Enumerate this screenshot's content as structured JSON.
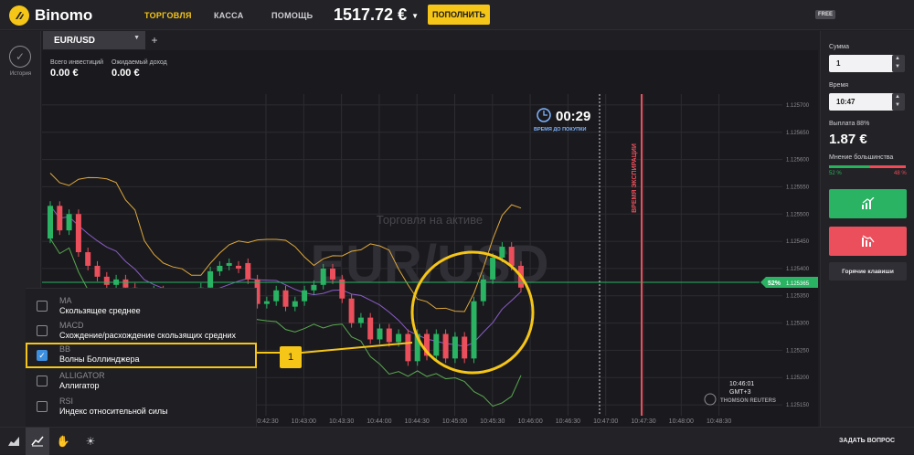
{
  "header": {
    "brand": "Binomo",
    "nav": [
      "ТОРГОВЛЯ",
      "КАССА",
      "ПОМОЩЬ"
    ],
    "balance": "1517.72 €",
    "deposit_label": "ПОПОЛНИТЬ",
    "free_badge": "FREE"
  },
  "left_rail": {
    "history_label": "История"
  },
  "asset_tab": {
    "label": "EUR/USD",
    "add_label": "+"
  },
  "investment": {
    "total_label": "Всего инвестиций",
    "total_value": "0.00 €",
    "expected_label": "Ожидаемый доход",
    "expected_value": "0.00 €"
  },
  "chart": {
    "timer": "00:29",
    "timer_caption": "ВРЕМЯ ДО ПОКУПКИ",
    "expiry_label": "ВРЕМЯ ЭКСПИРАЦИИ",
    "watermark_caption": "Торговля на активе",
    "watermark_asset": "EUR/USD",
    "clock": "10:46:01",
    "timezone": "GMT+3",
    "provider": "THOMSON REUTERS",
    "current_pct": "52%",
    "current_price": "1.125365",
    "price_ticks": [
      "1.125700",
      "1.125650",
      "1.125600",
      "1.125550",
      "1.125500",
      "1.125450",
      "1.125400",
      "1.125350",
      "1.125300",
      "1.125250",
      "1.125200",
      "1.125150"
    ],
    "time_ticks": [
      "10:42:30",
      "10:43:00",
      "10:43:30",
      "10:44:00",
      "10:44:30",
      "10:45:00",
      "10:45:30",
      "10:46:00",
      "10:46:30",
      "10:47:00",
      "10:47:30",
      "10:48:00",
      "10:48:30"
    ],
    "colors": {
      "up": "#29b362",
      "down": "#ea4f5b",
      "bb_upper": "#e0a83a",
      "bb_mid": "#8a5cc7",
      "bb_lower": "#5aa84f",
      "expiry": "#ea4f5b",
      "highlight": "#f5c518"
    }
  },
  "chart_data": {
    "type": "candlestick",
    "title": "",
    "candles": [
      {
        "o": 1.125455,
        "c": 1.125515
      },
      {
        "o": 1.125515,
        "c": 1.12547
      },
      {
        "o": 1.12547,
        "c": 1.1255
      },
      {
        "o": 1.1255,
        "c": 1.12543
      },
      {
        "o": 1.12543,
        "c": 1.125405
      },
      {
        "o": 1.125405,
        "c": 1.125385
      },
      {
        "o": 1.125385,
        "c": 1.12537
      },
      {
        "o": 1.12537,
        "c": 1.12538
      },
      {
        "o": 1.12538,
        "c": 1.125365
      },
      {
        "o": 1.125365,
        "c": 1.125355
      },
      {
        "o": 1.125355,
        "c": 1.125345
      },
      {
        "o": 1.125345,
        "c": 1.12536
      },
      {
        "o": 1.12536,
        "c": 1.12535
      },
      {
        "o": 1.12535,
        "c": 1.12534
      },
      {
        "o": 1.12534,
        "c": 1.125355
      },
      {
        "o": 1.125355,
        "c": 1.125345
      },
      {
        "o": 1.125345,
        "c": 1.125365
      },
      {
        "o": 1.125365,
        "c": 1.125395
      },
      {
        "o": 1.125395,
        "c": 1.125405
      },
      {
        "o": 1.125405,
        "c": 1.12541
      },
      {
        "o": 1.125405,
        "c": 1.1254
      },
      {
        "o": 1.12541,
        "c": 1.12538
      },
      {
        "o": 1.12538,
        "c": 1.125335
      },
      {
        "o": 1.125335,
        "c": 1.12534
      },
      {
        "o": 1.12534,
        "c": 1.12536
      },
      {
        "o": 1.12536,
        "c": 1.12533
      },
      {
        "o": 1.12533,
        "c": 1.12534
      },
      {
        "o": 1.12534,
        "c": 1.12536
      },
      {
        "o": 1.12536,
        "c": 1.12537
      },
      {
        "o": 1.12537,
        "c": 1.1254
      },
      {
        "o": 1.1254,
        "c": 1.12538
      },
      {
        "o": 1.12538,
        "c": 1.125345
      },
      {
        "o": 1.125345,
        "c": 1.1253
      },
      {
        "o": 1.1253,
        "c": 1.12531
      },
      {
        "o": 1.12531,
        "c": 1.12527
      },
      {
        "o": 1.12527,
        "c": 1.12529
      },
      {
        "o": 1.12529,
        "c": 1.125265
      },
      {
        "o": 1.125265,
        "c": 1.12528
      },
      {
        "o": 1.12528,
        "c": 1.12523
      },
      {
        "o": 1.12523,
        "c": 1.12528
      },
      {
        "o": 1.12528,
        "c": 1.12524
      },
      {
        "o": 1.12524,
        "c": 1.12528
      },
      {
        "o": 1.12528,
        "c": 1.125235
      },
      {
        "o": 1.125235,
        "c": 1.125275
      },
      {
        "o": 1.125275,
        "c": 1.125235
      },
      {
        "o": 1.125235,
        "c": 1.12534
      },
      {
        "o": 1.12534,
        "c": 1.12538
      },
      {
        "o": 1.12538,
        "c": 1.12542
      },
      {
        "o": 1.12542,
        "c": 1.12544
      },
      {
        "o": 1.12544,
        "c": 1.125405
      },
      {
        "o": 1.125405,
        "c": 1.125365
      }
    ],
    "ylim": [
      1.12513,
      1.12572
    ]
  },
  "right_panel": {
    "amount_label": "Сумма",
    "amount_value": "1",
    "time_label": "Время",
    "time_value": "10:47",
    "payout_label": "Выплата 88%",
    "payout_value": "1.87 €",
    "majority_label": "Мнение большинства",
    "majority_up": "52 %",
    "majority_down": "48 %",
    "majority_up_fraction": 0.52,
    "hotkeys_label": "Горячие клавиши"
  },
  "indicators": [
    {
      "code": "MA",
      "name": "Скользящее среднее",
      "checked": false
    },
    {
      "code": "MACD",
      "name": "Схождение/расхождение скользящих средних",
      "checked": false
    },
    {
      "code": "BB",
      "name": "Волны Боллинджера",
      "checked": true
    },
    {
      "code": "ALLIGATOR",
      "name": "Аллигатор",
      "checked": false
    },
    {
      "code": "RSI",
      "name": "Индекс относительной силы",
      "checked": false
    }
  ],
  "callout": "1",
  "footer": {
    "ask_label": "ЗАДАТЬ ВОПРОС"
  }
}
